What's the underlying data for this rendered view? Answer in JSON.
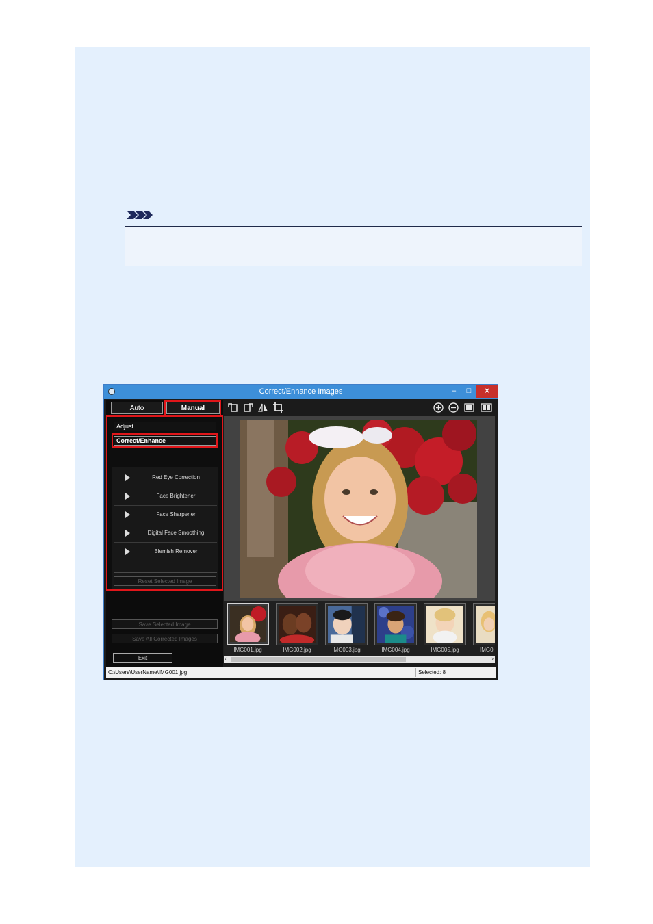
{
  "window": {
    "title": "Correct/Enhance Images",
    "minimize_glyph": "–",
    "maximize_glyph": "□",
    "close_glyph": "✕"
  },
  "tabs": [
    {
      "label": "Auto",
      "active": false
    },
    {
      "label": "Manual",
      "active": true
    }
  ],
  "sections": {
    "adjust": "Adjust",
    "correct_enhance": "Correct/Enhance"
  },
  "tools": [
    {
      "label": "Red Eye Correction",
      "icon": "play-arrow-icon"
    },
    {
      "label": "Face Brightener",
      "icon": "play-arrow-icon"
    },
    {
      "label": "Face Sharpener",
      "icon": "play-arrow-icon"
    },
    {
      "label": "Digital Face Smoothing",
      "icon": "play-arrow-icon"
    },
    {
      "label": "Blemish Remover",
      "icon": "play-arrow-icon"
    }
  ],
  "buttons": {
    "reset_selected": "Reset Selected Image",
    "save_selected": "Save Selected Image",
    "save_all": "Save All Corrected Images",
    "exit": "Exit"
  },
  "toolbar_icons": [
    "rotate-left-icon",
    "rotate-right-icon",
    "flip-horizontal-icon",
    "crop-icon",
    "zoom-in-icon",
    "zoom-out-icon",
    "whole-image-view-icon",
    "compare-view-icon"
  ],
  "thumbnails": [
    {
      "label": "IMG001.jpg",
      "selected": true
    },
    {
      "label": "IMG002.jpg",
      "selected": false
    },
    {
      "label": "IMG003.jpg",
      "selected": false
    },
    {
      "label": "IMG004.jpg",
      "selected": false
    },
    {
      "label": "IMG005.jpg",
      "selected": false
    },
    {
      "label": "IMG0",
      "selected": false
    }
  ],
  "status": {
    "path": "C:\\Users\\UserName\\IMG001.jpg",
    "selected": "Selected: 8"
  },
  "colors": {
    "highlight_red": "#e0161a",
    "titlebar_blue": "#3d8fd9",
    "page_background": "#e4f0fd"
  }
}
